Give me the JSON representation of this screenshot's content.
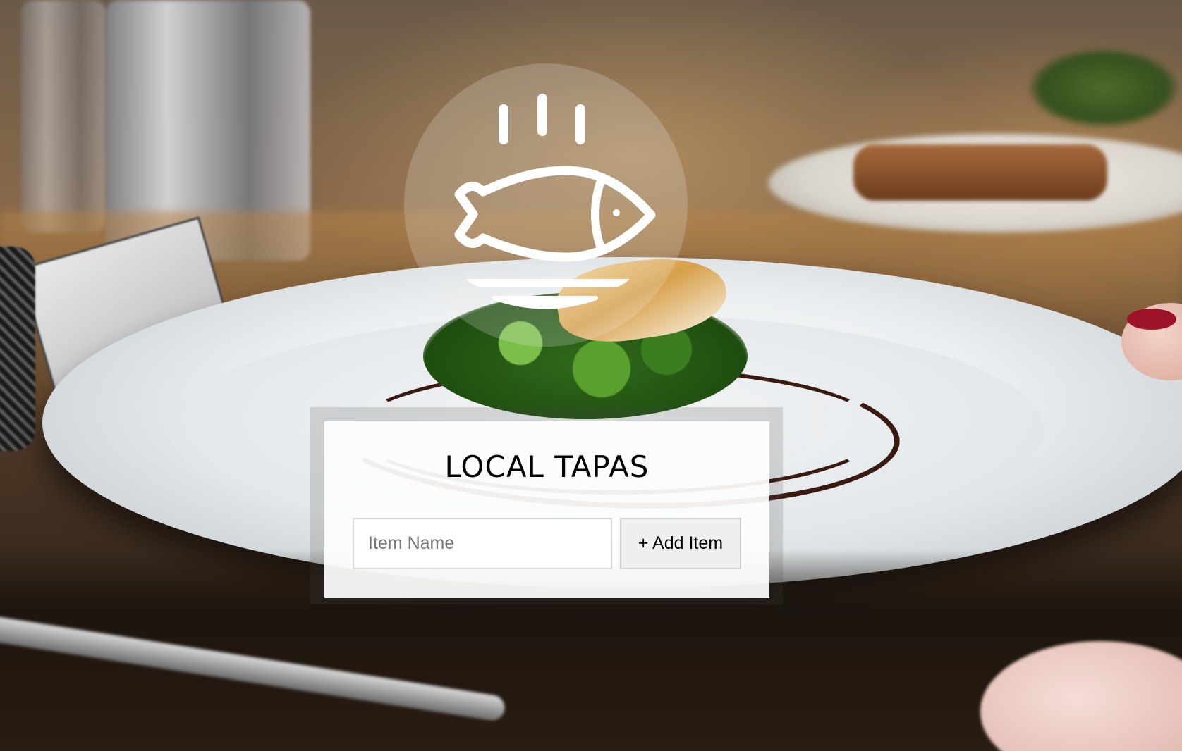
{
  "app": {
    "title": "LOCAL TAPAS"
  },
  "logo": {
    "icon": "fish-on-plate-steam-icon",
    "color": "#ffffff"
  },
  "background": {
    "image": "restaurant-plated-dish-photo"
  },
  "form": {
    "item_input": {
      "value": "",
      "placeholder": "Item Name"
    },
    "add_button_label": "+ Add Item"
  },
  "colors": {
    "panel_background": "#ffffff",
    "button_background": "#efefef",
    "text": "#000000"
  }
}
